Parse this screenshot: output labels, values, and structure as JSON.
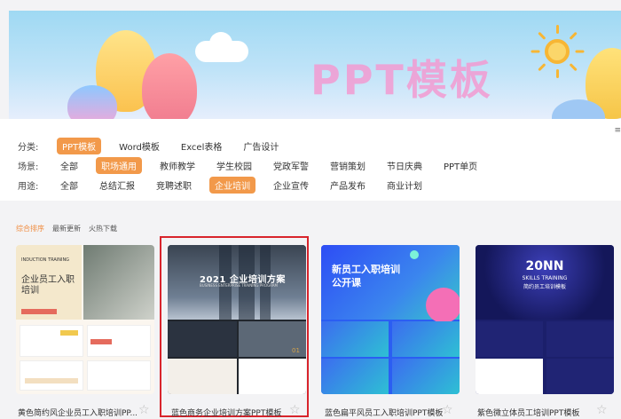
{
  "banner": {
    "title": "PPT模板"
  },
  "filters": {
    "rows": [
      {
        "label": "分类:",
        "options": [
          "PPT模板",
          "Word模板",
          "Excel表格",
          "广告设计"
        ],
        "active": 0
      },
      {
        "label": "场景:",
        "options": [
          "全部",
          "职场通用",
          "教师教学",
          "学生校园",
          "党政军警",
          "营销策划",
          "节日庆典",
          "PPT单页"
        ],
        "active": 1
      },
      {
        "label": "用途:",
        "options": [
          "全部",
          "总结汇报",
          "竞聘述职",
          "企业培训",
          "企业宣传",
          "产品发布",
          "商业计划"
        ],
        "active": 3
      }
    ],
    "corner_icon": "corner-icon"
  },
  "sort": {
    "options": [
      "综合排序",
      "最新更新",
      "火热下载"
    ],
    "active": 0
  },
  "cards": [
    {
      "title": "黄色简约风企业员工入职培训PP...",
      "thumb": {
        "en": "INDUCTION TRAINING",
        "zh": "企业员工入职培训"
      }
    },
    {
      "title": "蓝色商务企业培训方案PPT模板",
      "thumb": {
        "headline": "2021 企业培训方案",
        "sub": "BUSINESS   ENTERPRISE TRAINING PROGRAM",
        "num": "01"
      }
    },
    {
      "title": "蓝色扁平风员工入职培训PPT模板",
      "thumb": {
        "headline": "新员工入职培训",
        "headline2": "公开课"
      }
    },
    {
      "title": "紫色微立体员工培训PPT模板",
      "thumb": {
        "headline": "20NN",
        "sub": "SKILLS TRAINING",
        "zh": "简约员工培训模板"
      }
    }
  ],
  "selected_card": 1,
  "colors": {
    "accent": "#f2994a",
    "selection_border": "#d8242c",
    "banner_title": "#f39bd2"
  }
}
